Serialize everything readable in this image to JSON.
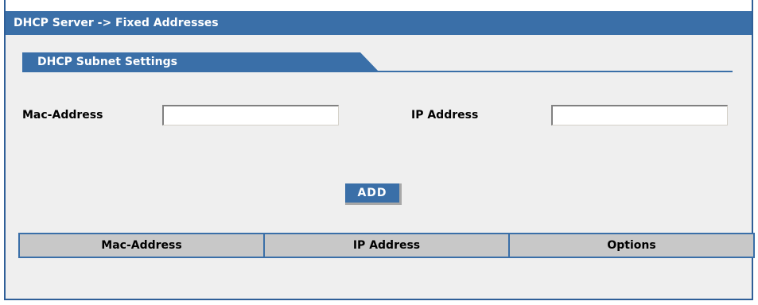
{
  "header": {
    "title": "DHCP Server -> Fixed Addresses"
  },
  "section": {
    "title": "DHCP Subnet Settings"
  },
  "form": {
    "mac_label": "Mac-Address",
    "mac_value": "",
    "ip_label": "IP Address",
    "ip_value": "",
    "add_label": "ADD"
  },
  "table": {
    "columns": [
      "Mac-Address",
      "IP Address",
      "Options"
    ],
    "rows": []
  },
  "colors": {
    "accent": "#3a6fa8",
    "panel_bg": "#efefef",
    "header_bg": "#c8c8c8"
  }
}
